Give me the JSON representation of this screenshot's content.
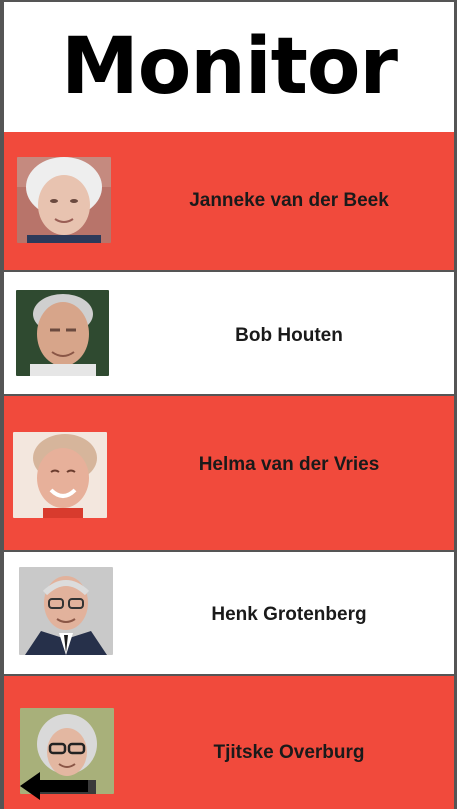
{
  "header": {
    "title": "Monitor"
  },
  "people": [
    {
      "name": "Janneke van der Beek",
      "row_color": "#f14a3c",
      "photo": "elderly-woman-white-hair-photo"
    },
    {
      "name": "Bob Houten",
      "row_color": "#ffffff",
      "photo": "elderly-man-smiling-photo"
    },
    {
      "name": "Helma van der Vries",
      "row_color": "#f14a3c",
      "photo": "elderly-woman-laughing-photo"
    },
    {
      "name": "Henk Grotenberg",
      "row_color": "#ffffff",
      "photo": "elderly-man-glasses-suit-photo"
    },
    {
      "name": "Tjitske Overburg",
      "row_color": "#f14a3c",
      "photo": "elderly-woman-glasses-photo"
    }
  ],
  "navigation": {
    "back_icon": "back-arrow-icon"
  },
  "colors": {
    "accent_red": "#f14a3c",
    "divider": "#555555"
  }
}
